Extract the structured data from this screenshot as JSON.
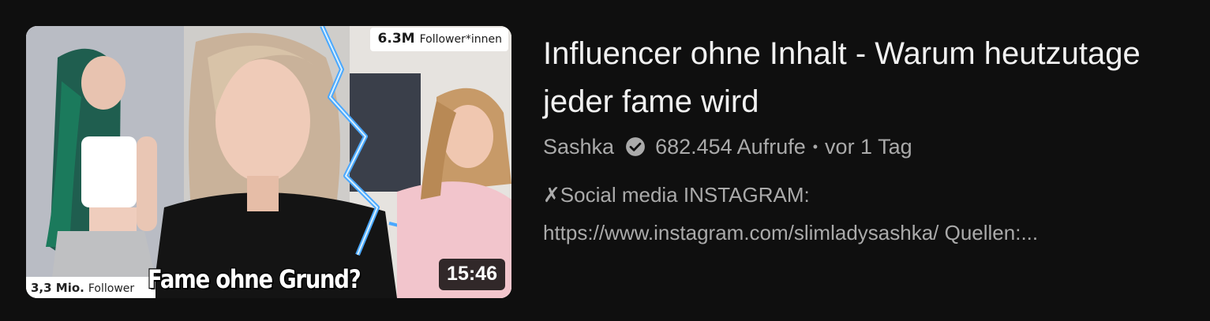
{
  "video": {
    "title": "Influencer ohne Inhalt - Warum heutzutage jeder fame wird",
    "channel": "Sashka",
    "views": "682.454 Aufrufe",
    "separator": "•",
    "age": "vor 1 Tag",
    "duration": "15:46",
    "description_line1": "✗Social media INSTAGRAM:",
    "description_line2": "https://www.instagram.com/slimladysashka/ Quellen:..."
  },
  "thumbnail": {
    "follower_top_count": "6.3M",
    "follower_top_label": "Follower*innen",
    "follower_bottom_count": "3,3 Mio.",
    "follower_bottom_label": "Follower",
    "caption": "Fame ohne Grund?"
  },
  "icons": {
    "verified": "check-circle-icon"
  },
  "colors": {
    "background": "#0f0f0f",
    "title": "#f1f1f1",
    "secondary_text": "#aaaaaa",
    "lightning": "#4aa8ff"
  }
}
